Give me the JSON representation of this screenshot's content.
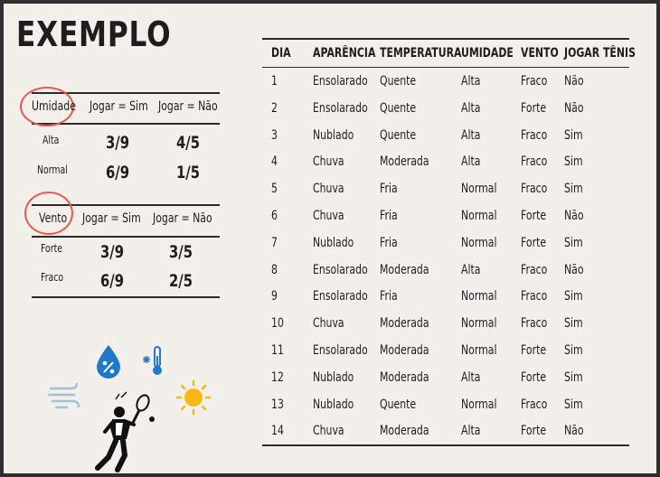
{
  "title": "EXEMPLO",
  "umidade_table": {
    "headers": [
      "Umidade",
      "Jogar = Sim",
      "Jogar = Não"
    ],
    "rows": [
      {
        "label": "Alta",
        "sim": "3/9",
        "nao": "4/5"
      },
      {
        "label": "Normal",
        "sim": "6/9",
        "nao": "1/5"
      }
    ]
  },
  "vento_table": {
    "headers": [
      "Vento",
      "Jogar = Sim",
      "Jogar = Não"
    ],
    "rows": [
      {
        "label": "Forte",
        "sim": "3/9",
        "nao": "3/5"
      },
      {
        "label": "Fraco",
        "sim": "6/9",
        "nao": "2/5"
      }
    ]
  },
  "main_table": {
    "headers": [
      "DIA",
      "APARÊNCIA",
      "TEMPERATURA",
      "UMIDADE",
      "VENTO",
      "JOGAR TÊNIS"
    ],
    "rows": [
      [
        "1",
        "Ensolarado",
        "Quente",
        "Alta",
        "Fraco",
        "Não"
      ],
      [
        "2",
        "Ensolarado",
        "Quente",
        "Alta",
        "Forte",
        "Não"
      ],
      [
        "3",
        "Nublado",
        "Quente",
        "Alta",
        "Fraco",
        "Sim"
      ],
      [
        "4",
        "Chuva",
        "Moderada",
        "Alta",
        "Fraco",
        "Sim"
      ],
      [
        "5",
        "Chuva",
        "Fria",
        "Normal",
        "Fraco",
        "Sim"
      ],
      [
        "6",
        "Chuva",
        "Fria",
        "Normal",
        "Forte",
        "Não"
      ],
      [
        "7",
        "Nublado",
        "Fria",
        "Normal",
        "Forte",
        "Sim"
      ],
      [
        "8",
        "Ensolarado",
        "Moderada",
        "Alta",
        "Fraco",
        "Não"
      ],
      [
        "9",
        "Ensolarado",
        "Fria",
        "Normal",
        "Fraco",
        "Sim"
      ],
      [
        "10",
        "Chuva",
        "Moderada",
        "Normal",
        "Fraco",
        "Sim"
      ],
      [
        "11",
        "Ensolarado",
        "Moderada",
        "Normal",
        "Forte",
        "Sim"
      ],
      [
        "12",
        "Nublado",
        "Moderada",
        "Alta",
        "Forte",
        "Sim"
      ],
      [
        "13",
        "Nublado",
        "Quente",
        "Normal",
        "Fraco",
        "Sim"
      ],
      [
        "14",
        "Chuva",
        "Moderada",
        "Alta",
        "Forte",
        "Não"
      ]
    ]
  },
  "icons": [
    "wind-icon",
    "humidity-drop-icon",
    "cold-thermometer-icon",
    "sun-icon",
    "tennis-player-icon"
  ],
  "colors": {
    "highlight_circle": "#e8584b",
    "drop_blue": "#1f78c8",
    "sun_yellow": "#f5b918"
  }
}
